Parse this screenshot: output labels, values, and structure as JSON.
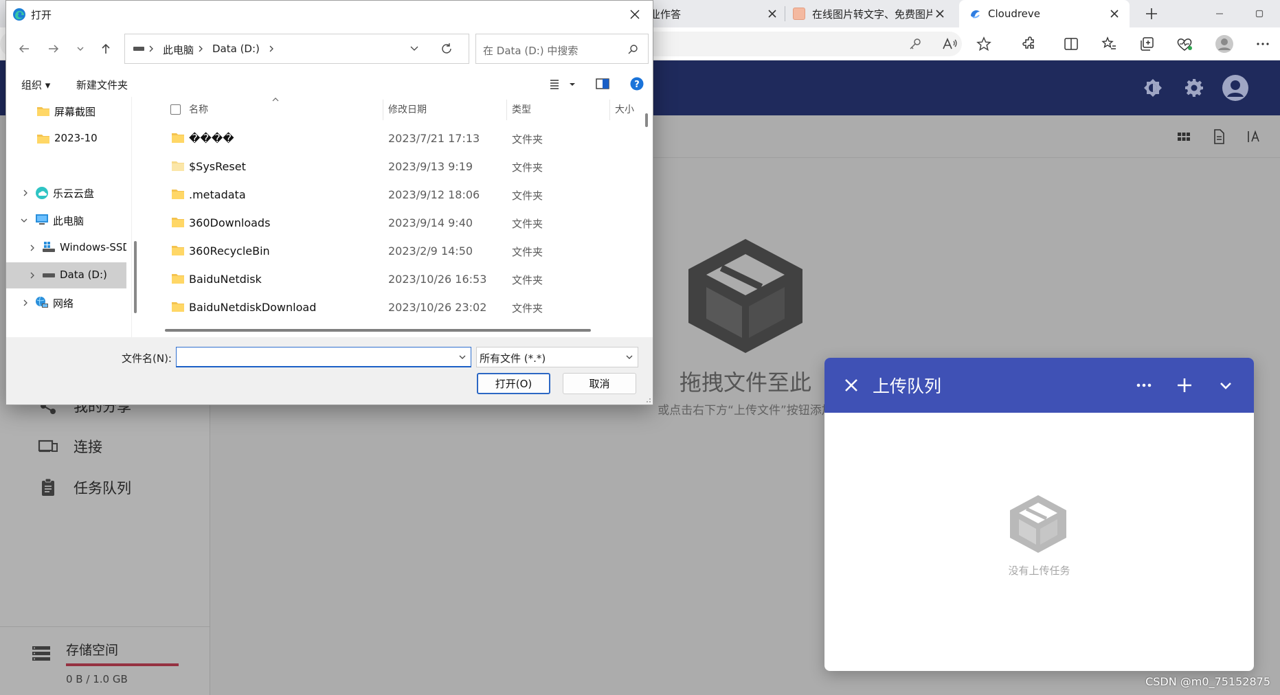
{
  "browser": {
    "tabs": [
      {
        "title": "业作答"
      },
      {
        "title": "在线图片转文字、免费图片"
      },
      {
        "title": "Cloudreve"
      }
    ],
    "new_tab_label": "+"
  },
  "upload_queue": {
    "title": "上传队列",
    "empty_text": "没有上传任务"
  },
  "page": {
    "empty_title": "拖拽文件至此",
    "empty_sub": "或点击右下方“上传文件”按钮添加",
    "sidebar": {
      "items": [
        {
          "label": "我的分享"
        },
        {
          "label": "连接"
        },
        {
          "label": "任务队列"
        }
      ],
      "storage_title": "存储空间",
      "storage_usage": "0 B / 1.0 GB",
      "storage_fraction": 0
    },
    "watermark": "CSDN @m0_75152875",
    "colors": {
      "header": "#1f2a5c",
      "upload_header": "#3f51b5",
      "storage_bar": "#c8243f"
    }
  },
  "dialog": {
    "title": "打开",
    "breadcrumb": [
      "此电脑",
      "Data (D:)"
    ],
    "search_placeholder": "在 Data (D:) 中搜索",
    "commands": {
      "organize": "组织 ▾",
      "new_folder": "新建文件夹"
    },
    "nav": [
      {
        "label": "屏幕截图"
      },
      {
        "label": "2023-10"
      },
      {
        "label": "乐云云盘"
      },
      {
        "label": "此电脑"
      },
      {
        "label": "Windows-SSD"
      },
      {
        "label": "Data (D:)"
      },
      {
        "label": "网络"
      }
    ],
    "columns": {
      "name": "名称",
      "date": "修改日期",
      "type": "类型",
      "size": "大小"
    },
    "files": [
      {
        "name": "����",
        "date": "2023/7/21 17:13",
        "type": "文件夹"
      },
      {
        "name": "$SysReset",
        "date": "2023/9/13 9:19",
        "type": "文件夹"
      },
      {
        "name": ".metadata",
        "date": "2023/9/12 18:06",
        "type": "文件夹"
      },
      {
        "name": "360Downloads",
        "date": "2023/9/14 9:40",
        "type": "文件夹"
      },
      {
        "name": "360RecycleBin",
        "date": "2023/2/9 14:50",
        "type": "文件夹"
      },
      {
        "name": "BaiduNetdisk",
        "date": "2023/10/26 16:53",
        "type": "文件夹"
      },
      {
        "name": "BaiduNetdiskDownload",
        "date": "2023/10/26 23:02",
        "type": "文件夹"
      }
    ],
    "filename_label": "文件名(N):",
    "filename_value": "",
    "filter_value": "所有文件 (*.*)",
    "open_button": "打开(O)",
    "cancel_button": "取消"
  }
}
